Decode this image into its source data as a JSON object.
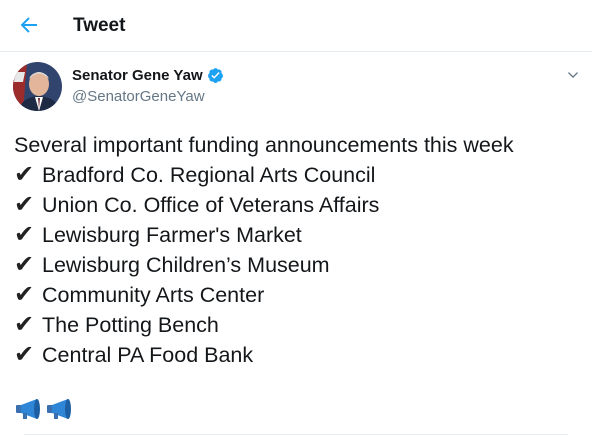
{
  "header": {
    "title": "Tweet"
  },
  "author": {
    "name": "Senator Gene Yaw",
    "handle": "@SenatorGeneYaw"
  },
  "tweet": {
    "intro": "Several important funding announcements this week",
    "check_glyph": "✔",
    "items": [
      "Bradford Co. Regional Arts Council",
      "Union Co. Office of Veterans Affairs",
      "Lewisburg Farmer's Market",
      "Lewisburg Children’s Museum",
      "Community Arts Center",
      "The Potting Bench",
      "Central PA Food Bank"
    ],
    "trailing_emoji": [
      "megaphone-icon",
      "megaphone-icon"
    ]
  },
  "colors": {
    "accent": "#1da1f2",
    "text": "#14171a",
    "secondary": "#657786",
    "divider": "#e6ecf0"
  }
}
